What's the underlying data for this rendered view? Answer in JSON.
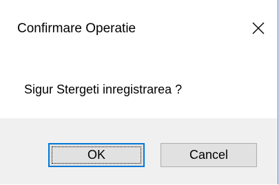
{
  "dialog": {
    "title": "Confirmare Operatie",
    "close_icon": "close-icon",
    "message": "Sigur Stergeti inregistrarea ?",
    "buttons": {
      "ok_label": "OK",
      "cancel_label": "Cancel"
    }
  },
  "colors": {
    "accent": "#0078d7",
    "footer_bg": "#f0f0f0",
    "button_bg": "#e1e1e1",
    "window_border": "#3c7fb1"
  }
}
